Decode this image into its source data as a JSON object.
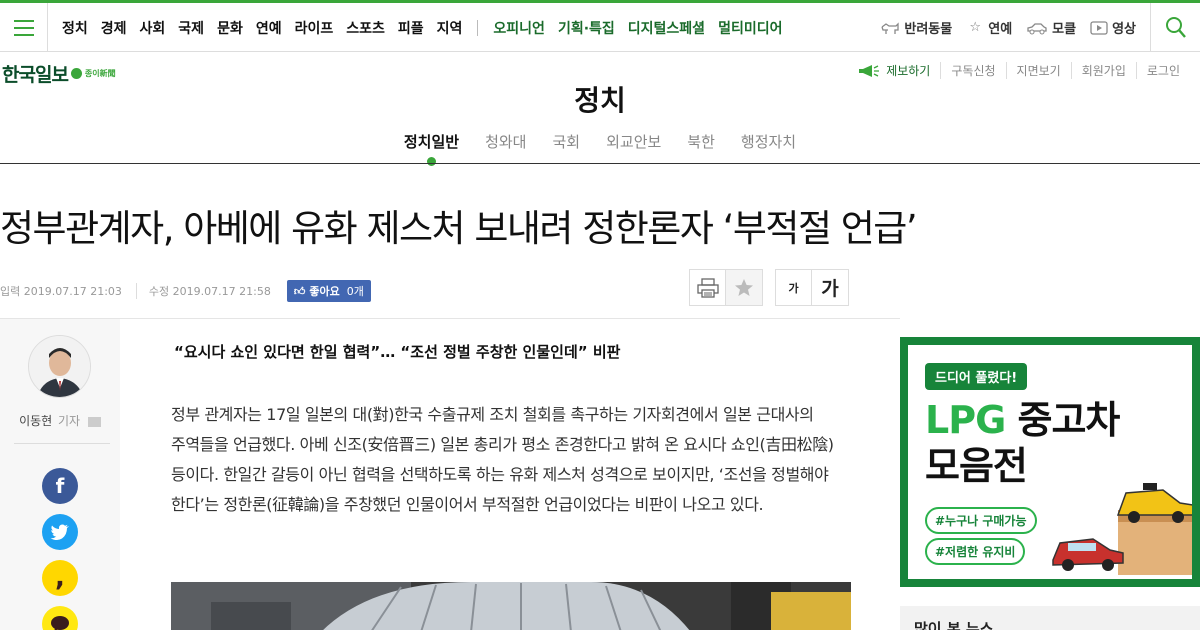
{
  "nav": {
    "items": [
      "정치",
      "경제",
      "사회",
      "국제",
      "문화",
      "연예",
      "라이프",
      "스포츠",
      "피플",
      "지역"
    ],
    "green_items": [
      "오피니언",
      "기획·특집",
      "디지털스페셜",
      "멀티미디어"
    ]
  },
  "utility": {
    "pets": "반려동물",
    "entertainment": "연예",
    "cars": "모클",
    "video": "영상"
  },
  "logo": {
    "text": "한국일보",
    "sub": "종이新聞"
  },
  "header_links": [
    "제보하기",
    "구독신청",
    "지면보기",
    "회원가입",
    "로그인"
  ],
  "section": {
    "title": "정치",
    "tabs": [
      "정치일반",
      "청와대",
      "국회",
      "외교안보",
      "북한",
      "행정자치"
    ],
    "active_tab": "정치일반"
  },
  "article": {
    "headline": "정부관계자, 아베에 유화 제스처 보내려 정한론자 ‘부적절 언급’",
    "input_time": "입력 2019.07.17 21:03",
    "modified_time": "수정 2019.07.17 21:58",
    "like_label": "좋아요",
    "like_count": "0개",
    "font_small": "가",
    "font_large": "가",
    "reporter_name": "이동현",
    "reporter_role": "기자",
    "subtitle": "“요시다 쇼인 있다면 한일 협력”… “조선 정벌 주창한 인물인데” 비판",
    "body": "정부 관계자는 17일 일본의 대(對)한국 수출규제 조치 철회를 촉구하는 기자회견에서 일본 근대사의 주역들을 언급했다. 아베 신조(安倍晋三) 일본 총리가 평소 존경한다고 밝혀 온 요시다 쇼인(吉田松陰) 등이다. 한일간 갈등이 아닌 협력을 선택하도록 하는 유화 제스처 성격으로 보이지만, ‘조선을 정벌해야 한다’는 정한론(征韓論)을 주창했던 인물이어서 부적절한 언급이었다는 비판이 나오고 있다."
  },
  "ad": {
    "badge": "드디어 풀렸다!",
    "title_accent": "LPG",
    "title_rest": " 중고차",
    "title_line2": "모음전",
    "tag1": "#누구나 구매가능",
    "tag2": "#저렴한 유지비"
  },
  "popular": {
    "title": "많이 본 뉴스"
  },
  "colors": {
    "brand_green": "#3aa63a",
    "dark_green": "#1a6b2b",
    "facebook": "#3b5998",
    "twitter": "#1da1f2"
  }
}
